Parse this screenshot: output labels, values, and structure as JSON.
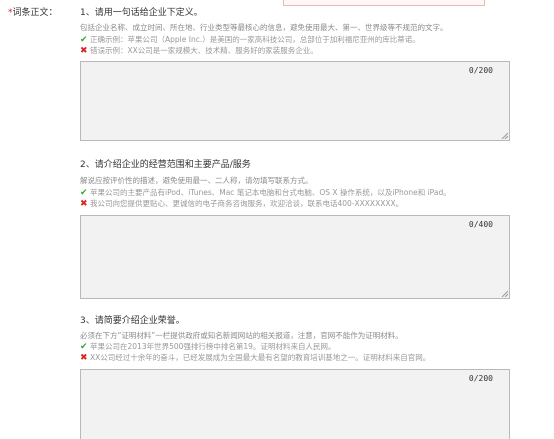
{
  "field": {
    "required_mark": "*",
    "label": "词条正文："
  },
  "sections": [
    {
      "question": "1、请用一句话给企业下定义。",
      "hint": "包括企业名称、成立时间、所在地、行业类型等最核心的信息，避免使用最大、第一、世界级等不规范的文字。",
      "good_example": "正确示例：苹果公司（Apple Inc.）是美国的一家高科技公司，总部位于加利福尼亚州的库比蒂诺。",
      "bad_example": "错误示例：XX公司是一家规模大、技术精、服务好的家装服务企业。",
      "counter": "0/200"
    },
    {
      "question": "2、请介绍企业的经营范围和主要产品/服务",
      "hint": "解说应按评价性的描述，避免使用最一、二人称，请勿填写联系方式。",
      "good_example": "苹果公司的主要产品有iPod、iTunes、Mac 笔记本电脑和台式电脑、OS X 操作系统，以及iPhone和 iPad。",
      "bad_example": "我公司向您提供更贴心、更诚信的电子商务咨询服务，欢迎洽谈，联系电话400-XXXXXXXX。",
      "counter": "0/400"
    },
    {
      "question": "3、请简要介绍企业荣誉。",
      "hint": "必须在下方“证明材料”一栏提供政府或知名新闻网站的相关报道，注意，官网不能作为证明材料。",
      "good_example": "苹果公司在2013年世界500强排行榜中排名第19。证明材料来自人民网。",
      "bad_example": "XX公司经过十余年的奋斗，已经发展成为全国最大最有名望的教育培训基地之一。证明材料来自官网。",
      "counter": "0/200"
    }
  ],
  "icons": {
    "check": "check-icon",
    "cross": "cross-icon"
  },
  "colors": {
    "required": "#d8261f",
    "ok": "#3aa33a",
    "bad": "#d8261f",
    "textarea_bg": "#f2f2f2"
  }
}
